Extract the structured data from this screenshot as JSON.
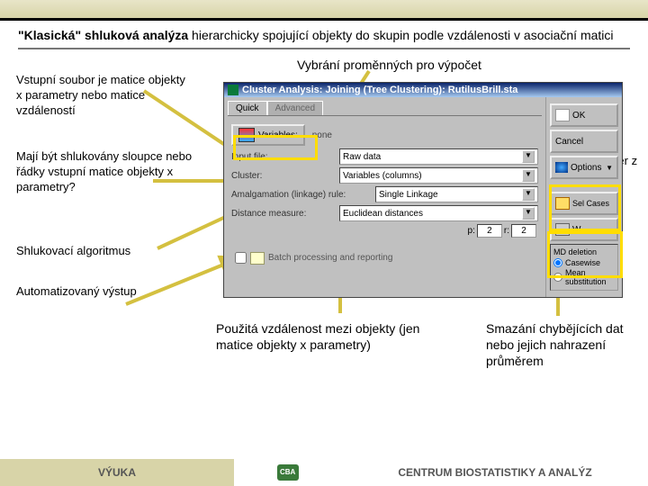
{
  "intro": {
    "strong": "\"Klasická\" shluková analýza",
    "rest": " hierarchicky spojující objekty do skupin podle vzdálenosti v asociační matici"
  },
  "labels": {
    "l1": "Vstupní soubor je matice objekty x parametry nebo matice vzdáleností",
    "l2": "Mají být shlukovány sloupce nebo řádky vstupní matice objekty x parametry?",
    "l3": "Shlukovací algoritmus",
    "l4": "Automatizovaný výstup",
    "l5": "Vybrání proměnných pro výpočet",
    "l6": "Výběr z dat",
    "l7": "Použitá vzdálenost mezi objekty (jen matice objekty x parametry)",
    "l8": "Smazání chybějících dat nebo jejich nahrazení průměrem"
  },
  "dialog": {
    "title": "Cluster Analysis: Joining (Tree Clustering): RutilusBrill.sta",
    "tabs": [
      "Quick",
      "Advanced"
    ],
    "variables_btn": "Variables:",
    "variables_val": "none",
    "fields": {
      "input_file": {
        "label": "Input file:",
        "val": "Raw data"
      },
      "cluster": {
        "label": "Cluster:",
        "val": "Variables (columns)"
      },
      "amalg": {
        "label": "Amalgamation (linkage) rule:",
        "val": "Single Linkage"
      },
      "dist": {
        "label": "Distance measure:",
        "val": "Euclidean distances"
      }
    },
    "pwr": {
      "p": "p:",
      "pval": "2",
      "r": "r:",
      "rval": "2"
    },
    "batch": "Batch processing and reporting",
    "side": {
      "ok": "OK",
      "cancel": "Cancel",
      "options": "Options",
      "selcases": "Sel Cases",
      "w": "W",
      "md_title": "MD deletion",
      "casewise": "Casewise",
      "mean": "Mean substitution"
    }
  },
  "footer": {
    "left": "VÝUKA",
    "right": "CENTRUM BIOSTATISTIKY A ANALÝZ"
  }
}
